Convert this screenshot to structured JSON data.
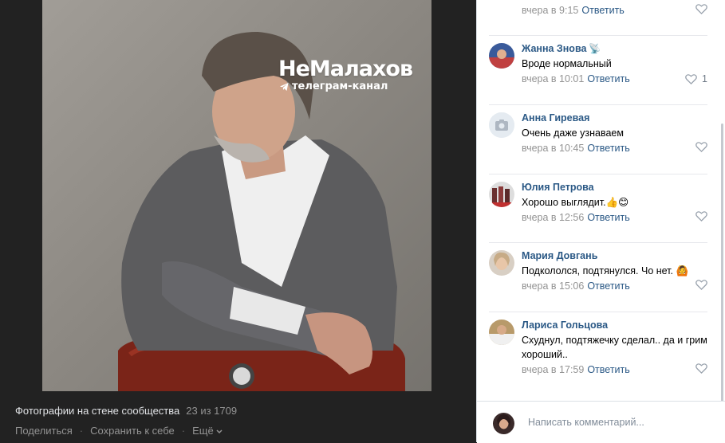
{
  "watermark": {
    "title": "НеМалахов",
    "subtitle": "телеграм-канал",
    "icon": "telegram-icon"
  },
  "viewer": {
    "album_title": "Фотографии на стене сообщества",
    "counter": "23 из 1709",
    "share_label": "Поделиться",
    "save_label": "Сохранить к себе",
    "more_label": "Ещё"
  },
  "comments": [
    {
      "author": "",
      "text": "",
      "time": "вчера в 9:15",
      "reply_label": "Ответить",
      "likes": ""
    },
    {
      "author": "Жанна Знова",
      "author_icon": "satellite-icon",
      "text": "Вроде нормальный",
      "time": "вчера в 10:01",
      "reply_label": "Ответить",
      "likes": "1"
    },
    {
      "author": "Анна Гиревая",
      "text": "Очень даже узнаваем",
      "time": "вчера в 10:45",
      "reply_label": "Ответить",
      "likes": ""
    },
    {
      "author": "Юлия Петрова",
      "text": "Хорошо выглядит.👍😊",
      "time": "вчера в 12:56",
      "reply_label": "Ответить",
      "likes": ""
    },
    {
      "author": "Мария Довгань",
      "text": "Подкололся, подтянулся. Чо нет. 🙆",
      "time": "вчера в 15:06",
      "reply_label": "Ответить",
      "likes": ""
    },
    {
      "author": "Лариса Гольцова",
      "text": "Схуднул, подтяжечку сделал.. да и грим хороший..",
      "time": "вчера в 17:59",
      "reply_label": "Ответить",
      "likes": ""
    }
  ],
  "composer": {
    "placeholder": "Написать комментарий..."
  },
  "colors": {
    "link": "#2a5885",
    "meta": "#939393",
    "viewer_bg": "#222222"
  }
}
